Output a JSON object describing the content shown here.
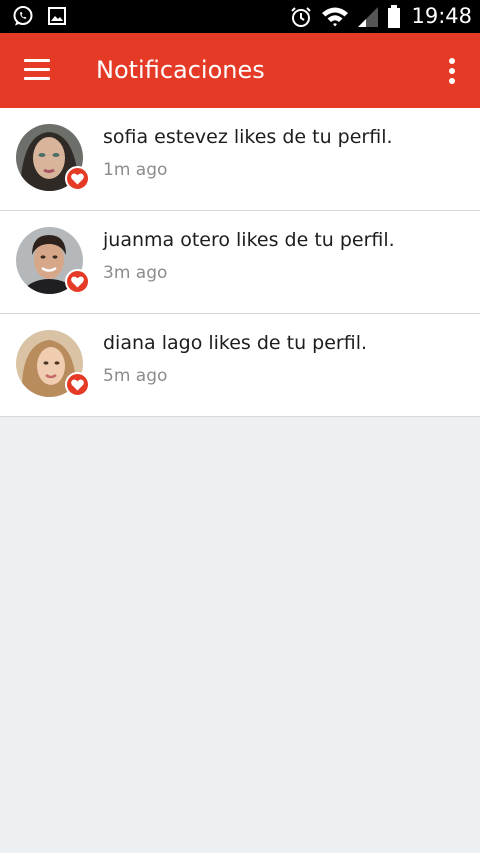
{
  "status_bar": {
    "left_icons": [
      "whatsapp-icon",
      "gallery-icon"
    ],
    "right_icons": [
      "alarm-icon",
      "wifi-icon",
      "signal-icon",
      "battery-icon"
    ],
    "time": "19:48"
  },
  "app_bar": {
    "title": "Notificaciones",
    "menu_icon": "hamburger-menu-icon",
    "overflow_icon": "more-vert-icon"
  },
  "colors": {
    "accent": "#e53a26",
    "background": "#edf0f2",
    "divider": "#d6d8da",
    "secondary_text": "#8c8c8c"
  },
  "notifications": [
    {
      "message": "sofia estevez likes de tu perfil.",
      "time": "1m ago",
      "badge_icon": "heart-icon"
    },
    {
      "message": "juanma otero likes de tu perfil.",
      "time": "3m ago",
      "badge_icon": "heart-icon"
    },
    {
      "message": "diana lago likes de tu perfil.",
      "time": "5m ago",
      "badge_icon": "heart-icon"
    }
  ]
}
